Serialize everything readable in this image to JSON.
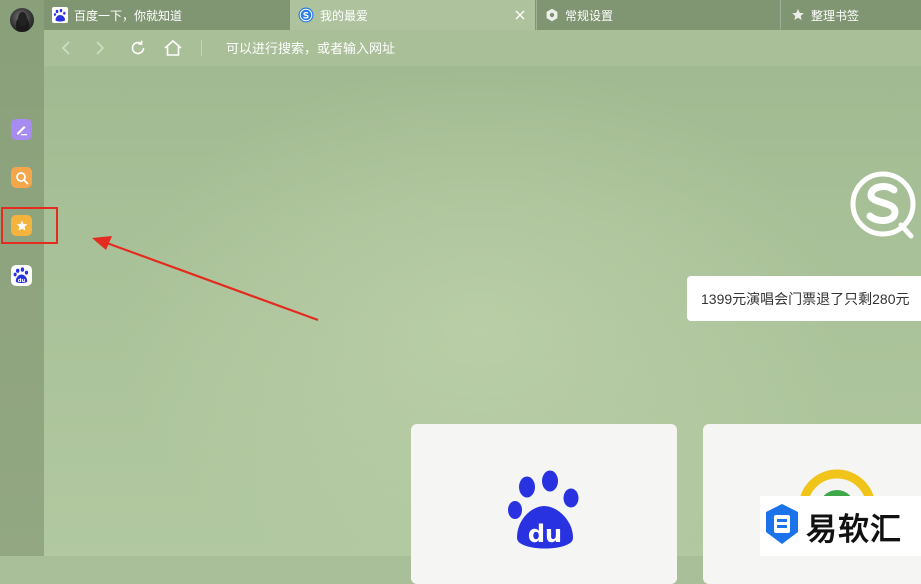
{
  "colors": {
    "accent_red": "#e42b20",
    "baidu_blue": "#2932e1",
    "sidebar_note": "#a78bf0",
    "sidebar_search": "#f4a64a",
    "sidebar_favorite": "#f4b33c"
  },
  "tabs": [
    {
      "label": "百度一下，你就知道",
      "icon": "baidu-paw-icon",
      "active": false
    },
    {
      "label": "我的最爱",
      "icon": "sogou-icon",
      "active": true
    },
    {
      "label": "常规设置",
      "icon": "gear-icon",
      "active": false
    },
    {
      "label": "整理书签",
      "icon": "star-icon",
      "active": false
    }
  ],
  "toolbar": {
    "address_placeholder": "可以进行搜索，或者输入网址"
  },
  "sidebar": {
    "items": [
      {
        "icon": "note-edit-icon"
      },
      {
        "icon": "search-icon"
      },
      {
        "icon": "favorite-star-icon",
        "highlighted": true
      },
      {
        "icon": "baidu-paw-icon"
      }
    ]
  },
  "main": {
    "news_suggestion": "1399元演唱会门票退了只剩280元",
    "tiles": [
      {
        "icon": "baidu-du-icon"
      },
      {
        "icon": "green-circle-logo-icon"
      }
    ]
  },
  "watermark": {
    "text": "易软汇"
  }
}
